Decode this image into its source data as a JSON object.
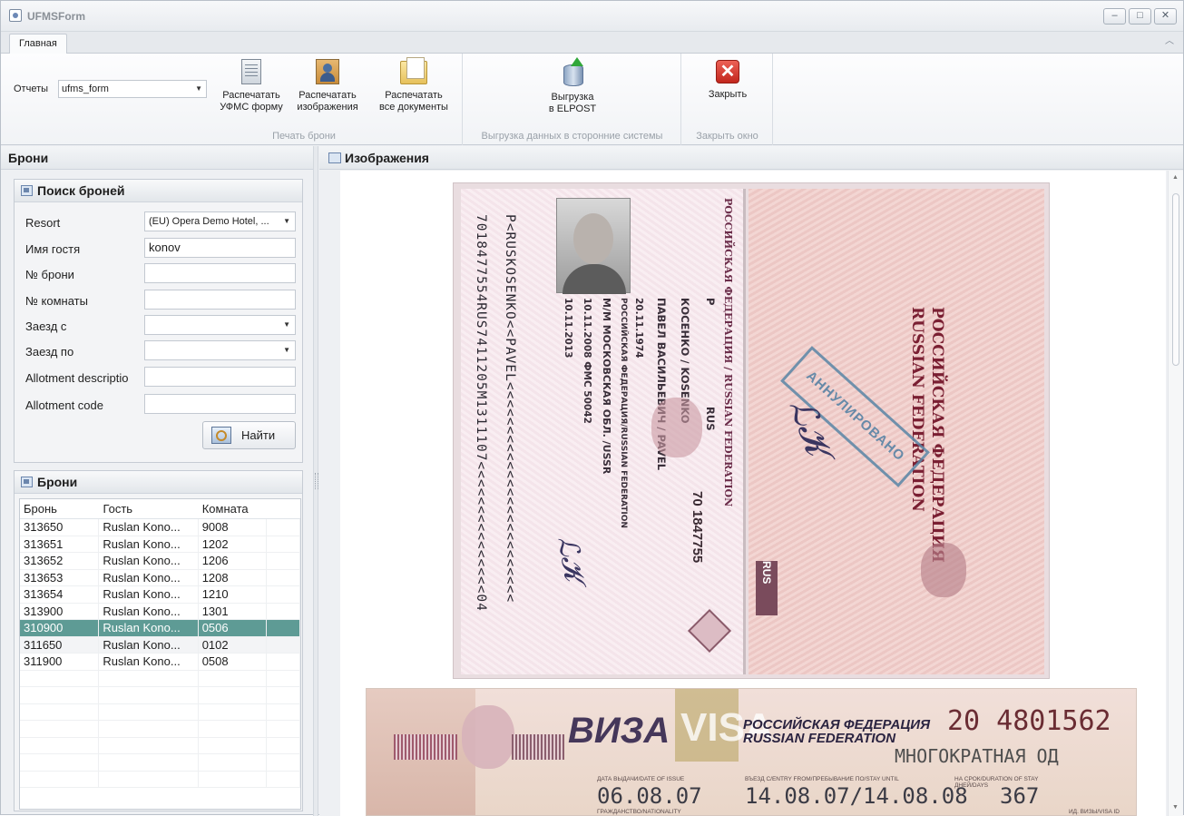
{
  "window": {
    "title": "UFMSForm"
  },
  "tabs": [
    {
      "label": "Главная"
    }
  ],
  "ribbon": {
    "reports_label": "Отчеты",
    "reports_value": "ufms_form",
    "groups": {
      "print": "Печать брони",
      "export": "Выгрузка данных в сторонние системы",
      "close": "Закрыть окно"
    },
    "buttons": {
      "print_ufms": [
        "Распечатать",
        "УФМС форму"
      ],
      "print_images": [
        "Распечатать",
        "изображения"
      ],
      "print_all": [
        "Распечатать",
        "все документы"
      ],
      "export_elpost": [
        "Выгрузка",
        "в ELPOST"
      ],
      "close": [
        "Закрыть"
      ]
    }
  },
  "left": {
    "header": "Брони",
    "search_panel": {
      "title": "Поиск броней",
      "fields": [
        {
          "label": "Resort",
          "value": "(EU) Opera Demo Hotel, ...",
          "combo": true
        },
        {
          "label": "Имя гостя",
          "value": "konov",
          "combo": false
        },
        {
          "label": "№ брони",
          "value": "",
          "combo": false
        },
        {
          "label": "№ комнаты",
          "value": "",
          "combo": false
        },
        {
          "label": "Заезд с",
          "value": "",
          "combo": true
        },
        {
          "label": "Заезд по",
          "value": "",
          "combo": true
        },
        {
          "label": "Allotment descriptio",
          "value": "",
          "combo": false
        },
        {
          "label": "Allotment code",
          "value": "",
          "combo": false
        }
      ],
      "find_label": "Найти"
    },
    "bookings_panel": {
      "title": "Брони",
      "columns": [
        "Бронь",
        "Гость",
        "Комната"
      ],
      "rows": [
        [
          "313650",
          "Ruslan Kono...",
          "9008"
        ],
        [
          "313651",
          "Ruslan Kono...",
          "1202"
        ],
        [
          "313652",
          "Ruslan Kono...",
          "1206"
        ],
        [
          "313653",
          "Ruslan Kono...",
          "1208"
        ],
        [
          "313654",
          "Ruslan Kono...",
          "1210"
        ],
        [
          "313900",
          "Ruslan Kono...",
          "1301"
        ],
        [
          "310900",
          "Ruslan Kono...",
          "0506"
        ],
        [
          "311650",
          "Ruslan Kono...",
          "0102"
        ],
        [
          "311900",
          "Ruslan Kono...",
          "0508"
        ]
      ],
      "selected_index": 6,
      "selected_color": "#5e9b95"
    }
  },
  "right": {
    "header": "Изображения",
    "passport": {
      "mrz_line1": "P<RUSKOSENKO<<PAVEL<<<<<<<<<<<<<<<<<<<<<<<<<",
      "mrz_line2": "7018477554RUS7411205M1311107<<<<<<<<<<<<<<<04",
      "title": "РОССИЙСКАЯ ФЕДЕРАЦИЯ / RUSSIAN FEDERATION",
      "number": "70 1847755",
      "surname": "КОСЕНКО / KOSENKO",
      "given_names": "ПАВЕЛ ВАСИЛЬЕВИЧ / PAVEL",
      "dob": "20.11.1974",
      "birthplace": "РОССИЙСКАЯ ФЕДЕРАЦИЯ/RUSSIAN FEDERATION",
      "sex_place": "М/М     МОСКОВСКАЯ ОБЛ. /USSR",
      "issued": "10.11.2008     ФМС 50042",
      "expiry": "10.11.2013",
      "code": "RUS",
      "type": "P",
      "right_title_1": "РОССИЙСКАЯ ФЕДЕРАЦИЯ",
      "right_title_2": "RUSSIAN FEDERATION",
      "stamp": "АННУЛИРОВАНО",
      "tag": "RUS"
    },
    "visa": {
      "word_ru": "ВИЗА",
      "word_en": "VISA",
      "country_ru": "РОССИЙСКАЯ ФЕДЕРАЦИЯ",
      "country_en": "RUSSIAN FEDERATION",
      "number": "20 4801562",
      "entries": "МНОГОКРАТНАЯ ОД",
      "issue_label": "ДАТА ВЫДАЧИ/DATE OF ISSUE",
      "entry_label": "ВЪЕЗД С/ENTRY FROM/ПРЕБЫВАНИЕ ПО/STAY UNTIL",
      "duration_label": "НА СРОК/DURATION OF STAY ДНЕЙ/DAYS",
      "issue_date": "06.08.07",
      "validity": "14.08.07/14.08.08",
      "days": "367",
      "nationality_label": "ГРАЖДАНСТВО/NATIONALITY",
      "visa_id_label": "ИД. ВИЗЫ/VISA ID"
    }
  }
}
